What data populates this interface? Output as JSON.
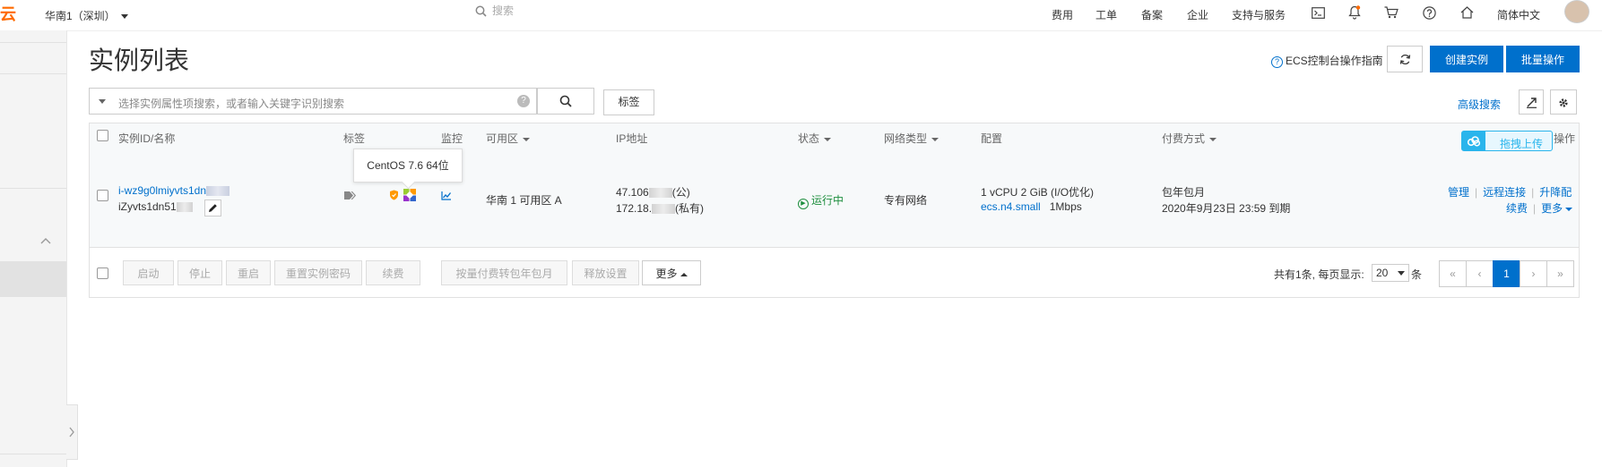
{
  "topbar": {
    "logo": "云",
    "region": "华南1（深圳）",
    "search_placeholder": "搜索",
    "nav": [
      "费用",
      "工单",
      "备案",
      "企业",
      "支持与服务"
    ],
    "icons": [
      "terminal-icon",
      "bell-icon",
      "cart-icon",
      "help-icon",
      "home-icon"
    ],
    "language": "简体中文"
  },
  "header": {
    "title": "实例列表",
    "guide_link": "ECS控制台操作指南",
    "create_label": "创建实例",
    "batch_label": "批量操作"
  },
  "filter": {
    "placeholder": "选择实例属性项搜索，或者输入关键字识别搜索",
    "tag_button": "标签",
    "advanced_search": "高级搜索"
  },
  "table": {
    "columns": [
      "实例ID/名称",
      "标签",
      "监控",
      "可用区",
      "IP地址",
      "状态",
      "网络类型",
      "配置",
      "付费方式",
      "操作"
    ],
    "rows": [
      {
        "instance_id": "i-wz9g0lmiyvts1dn",
        "instance_name": "iZyvts1dn51",
        "zone": "华南 1 可用区 A",
        "ip_public_prefix": "47.106",
        "ip_public_label": "(公)",
        "ip_private_prefix": "172.18.",
        "ip_private_label": "(私有)",
        "status": "运行中",
        "network": "专有网络",
        "spec": "1 vCPU 2 GiB (I/O优化)",
        "instance_type": "ecs.n4.small",
        "bandwidth": "1Mbps",
        "billing": "包年包月",
        "expire": "2020年9月23日 23:59 到期",
        "actions": [
          "管理",
          "远程连接",
          "升降配",
          "续费",
          "更多"
        ]
      }
    ],
    "os_tooltip": "CentOS 7.6 64位"
  },
  "upload_widget": "拖拽上传",
  "toolbar": {
    "buttons": [
      "启动",
      "停止",
      "重启",
      "重置实例密码",
      "续费",
      "按量付费转包年包月",
      "释放设置"
    ],
    "more": "更多"
  },
  "pagination": {
    "summary": "共有1条, 每页显示:",
    "page_size": "20",
    "unit": "条",
    "first": "«",
    "prev": "‹",
    "current": "1",
    "next": "›",
    "last": "»"
  },
  "colors": {
    "primary": "#0070cc",
    "brand": "#ff6a00",
    "running": "#1e8e3e",
    "upload": "#2ab5ec"
  }
}
